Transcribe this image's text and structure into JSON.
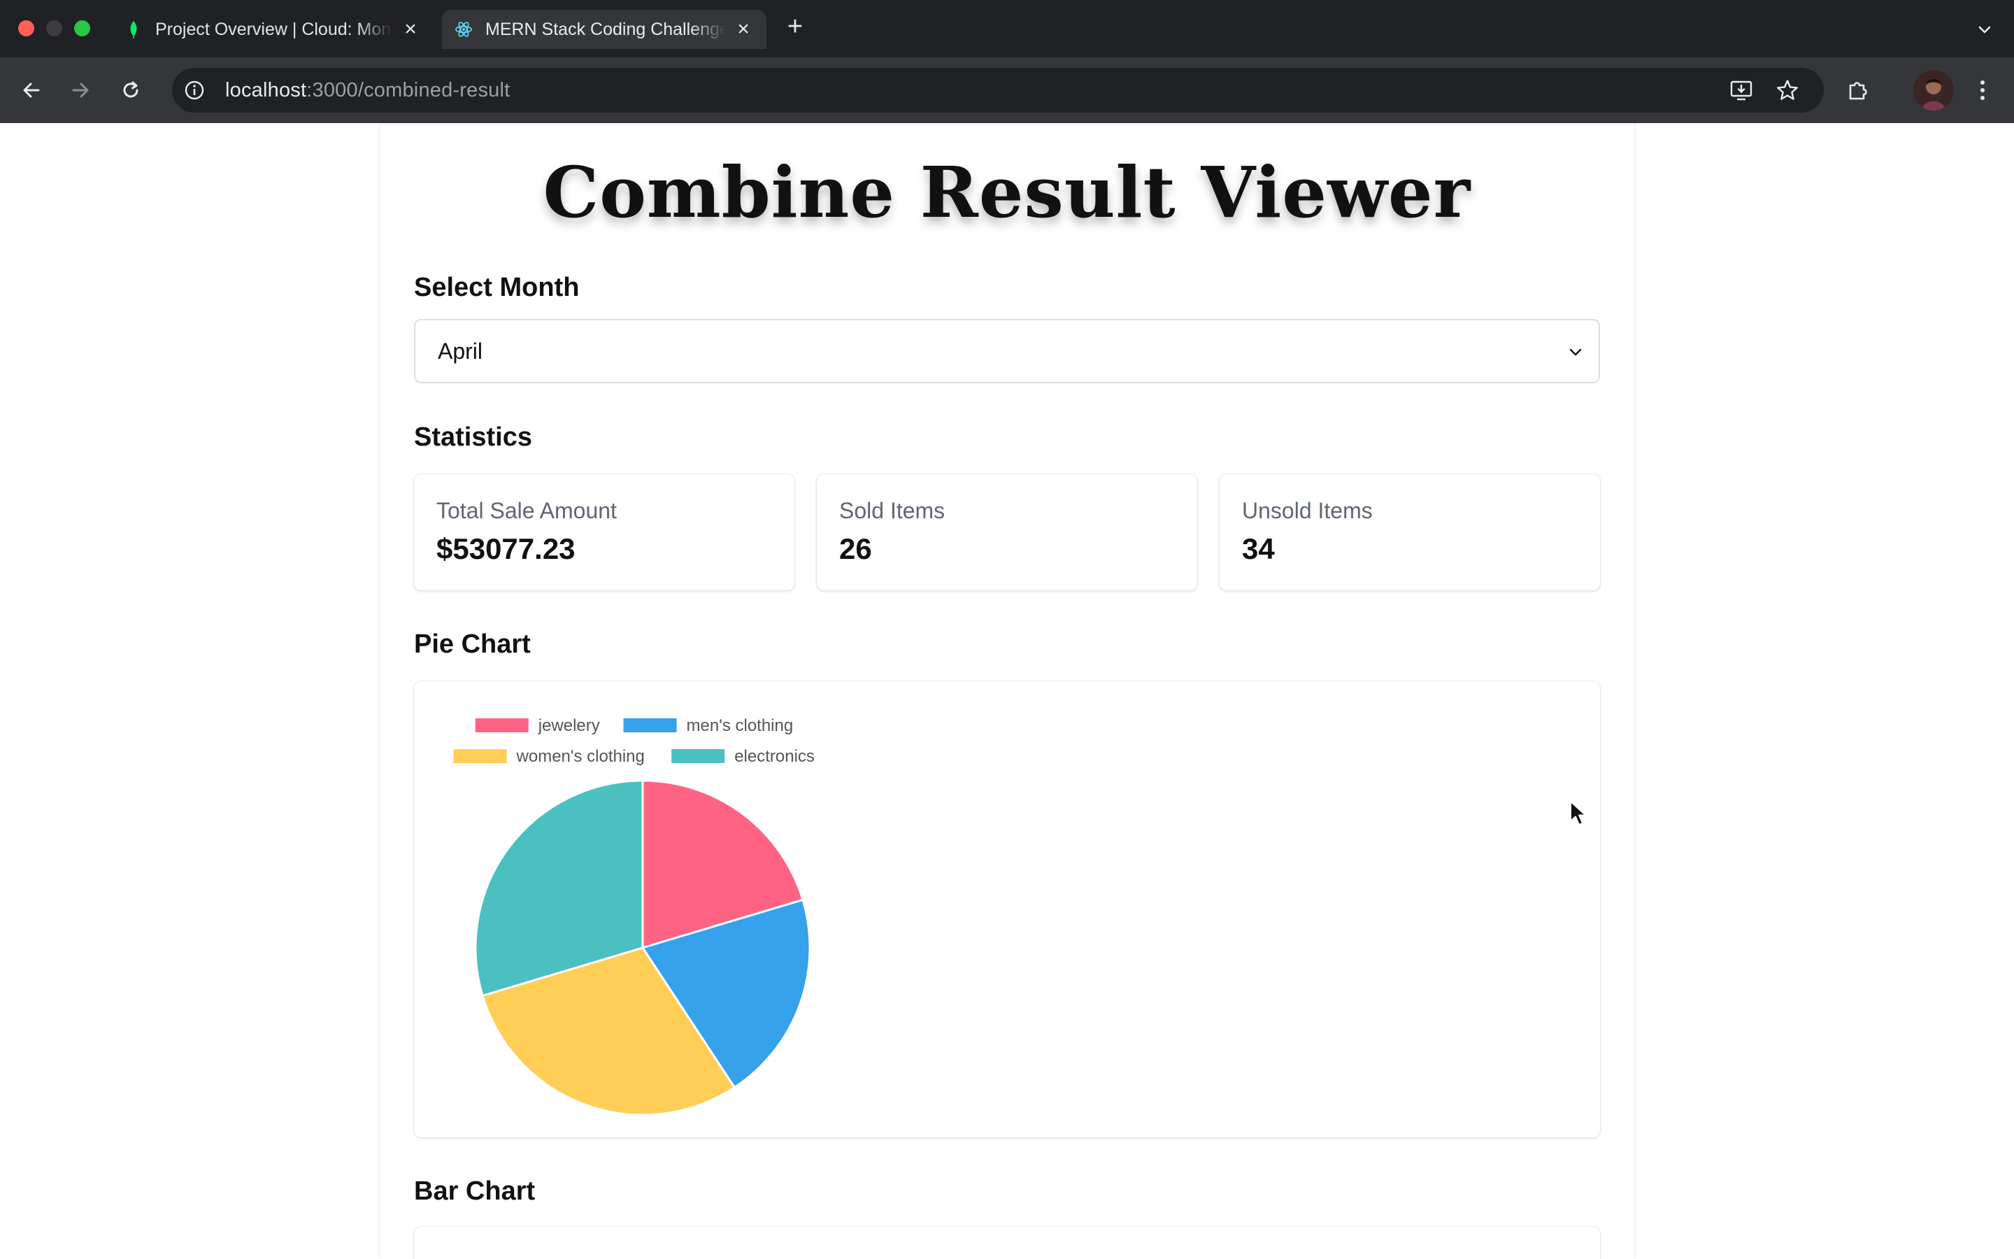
{
  "browser": {
    "tabs": [
      {
        "title": "Project Overview | Cloud: MongoDB Cloud",
        "active": false
      },
      {
        "title": "MERN Stack Coding Challenge",
        "active": true
      }
    ],
    "new_tab_symbol": "+",
    "url": {
      "host": "localhost",
      "path": ":3000/combined-result"
    }
  },
  "page": {
    "title": "Combine Result Viewer",
    "month_selector": {
      "label": "Select Month",
      "selected": "April"
    },
    "statistics": {
      "heading": "Statistics",
      "cards": [
        {
          "label": "Total Sale Amount",
          "value": "$53077.23"
        },
        {
          "label": "Sold Items",
          "value": "26"
        },
        {
          "label": "Unsold Items",
          "value": "34"
        }
      ]
    },
    "pie_section": {
      "heading": "Pie Chart"
    },
    "bar_section": {
      "heading": "Bar Chart"
    }
  },
  "colors": {
    "jewelery": "#ff6384",
    "mens_clothing": "#36a2eb",
    "womens_clothing": "#ffce56",
    "electronics": "#4bc0c0"
  },
  "chart_data": {
    "type": "pie",
    "categories": [
      "jewelery",
      "men's clothing",
      "women's clothing",
      "electronics"
    ],
    "values": [
      11,
      11,
      16,
      16
    ],
    "colors": [
      "#ff6384",
      "#36a2eb",
      "#ffce56",
      "#4bc0c0"
    ],
    "legend_position": "top"
  }
}
